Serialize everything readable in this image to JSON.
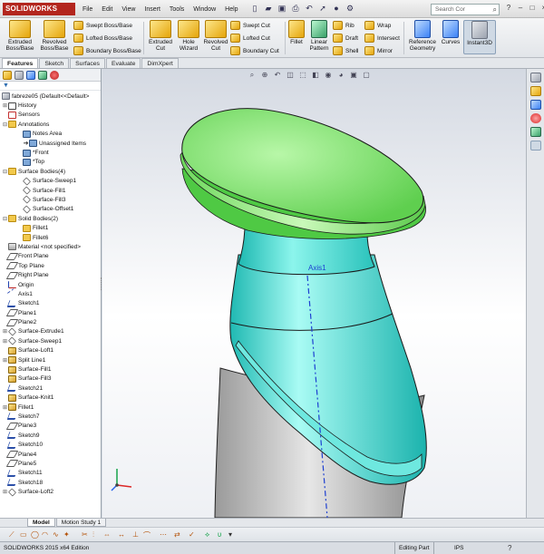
{
  "app": {
    "logo": "SOLIDWORKS"
  },
  "menu": [
    "File",
    "Edit",
    "View",
    "Insert",
    "Tools",
    "Window",
    "Help"
  ],
  "quick_access": [
    "new-icon",
    "open-icon",
    "save-icon",
    "print-icon",
    "undo-icon",
    "select-icon",
    "rebuild-icon",
    "options-icon"
  ],
  "search": {
    "placeholder": "Search Cor"
  },
  "window_controls": [
    "?",
    "–",
    "□",
    "×"
  ],
  "commands": {
    "extruded_boss": "Extruded Boss/Base",
    "revolved_boss": "Revolved Boss/Base",
    "swept_boss": "Swept Boss/Base",
    "lofted_boss": "Lofted Boss/Base",
    "boundary_boss": "Boundary Boss/Base",
    "extruded_cut": "Extruded Cut",
    "hole_wizard": "Hole Wizard",
    "revolved_cut": "Revolved Cut",
    "swept_cut": "Swept Cut",
    "lofted_cut": "Lofted Cut",
    "boundary_cut": "Boundary Cut",
    "fillet": "Fillet",
    "linear_pattern": "Linear Pattern",
    "rib": "Rib",
    "draft": "Draft",
    "shell": "Shell",
    "wrap": "Wrap",
    "intersect": "Intersect",
    "mirror": "Mirror",
    "reference_geometry": "Reference Geometry",
    "curves": "Curves",
    "instant3d": "Instant3D"
  },
  "tabs": [
    "Features",
    "Sketch",
    "Surfaces",
    "Evaluate",
    "DimXpert"
  ],
  "tree": {
    "filter": "▼",
    "root": "fabreze05  (Default<<Default>",
    "items": [
      {
        "label": "History",
        "icon": "history-icon",
        "exp": "⊞",
        "indent": 1
      },
      {
        "label": "Sensors",
        "icon": "sensor-icon",
        "exp": "",
        "indent": 1
      },
      {
        "label": "Annotations",
        "icon": "annotation-icon",
        "exp": "⊟",
        "indent": 1
      },
      {
        "label": "Notes Area",
        "icon": "notes-icon",
        "exp": "",
        "indent": 2
      },
      {
        "label": "Unassigned Items",
        "icon": "notes-icon",
        "exp": "",
        "indent": 2,
        "arrow": true
      },
      {
        "label": "*Front",
        "icon": "notes-icon",
        "exp": "",
        "indent": 2
      },
      {
        "label": "*Top",
        "icon": "notes-icon",
        "exp": "",
        "indent": 2
      },
      {
        "label": "Surface Bodies(4)",
        "icon": "folder-icon",
        "exp": "⊟",
        "indent": 1
      },
      {
        "label": "Surface-Sweep1",
        "icon": "surface-icon",
        "exp": "",
        "indent": 2
      },
      {
        "label": "Surface-Fill1",
        "icon": "surface-icon",
        "exp": "",
        "indent": 2
      },
      {
        "label": "Surface-Fill3",
        "icon": "surface-icon",
        "exp": "",
        "indent": 2
      },
      {
        "label": "Surface-Offset1",
        "icon": "surface-icon",
        "exp": "",
        "indent": 2
      },
      {
        "label": "Solid Bodies(2)",
        "icon": "folder-icon",
        "exp": "⊟",
        "indent": 1
      },
      {
        "label": "Fillet1",
        "icon": "folder-icon",
        "exp": "",
        "indent": 2
      },
      {
        "label": "Fillet6",
        "icon": "folder-icon",
        "exp": "",
        "indent": 2
      },
      {
        "label": "Material <not specified>",
        "icon": "material-icon",
        "exp": "",
        "indent": 1
      },
      {
        "label": "Front Plane",
        "icon": "plane-icon",
        "exp": "",
        "indent": 1
      },
      {
        "label": "Top Plane",
        "icon": "plane-icon",
        "exp": "",
        "indent": 1
      },
      {
        "label": "Right Plane",
        "icon": "plane-icon",
        "exp": "",
        "indent": 1
      },
      {
        "label": "Origin",
        "icon": "origin-icon",
        "exp": "",
        "indent": 1
      },
      {
        "label": "Axis1",
        "icon": "axis-icon",
        "exp": "",
        "indent": 1
      },
      {
        "label": "Sketch1",
        "icon": "sketch-icon",
        "exp": "",
        "indent": 1
      },
      {
        "label": "Plane1",
        "icon": "plane-icon",
        "exp": "",
        "indent": 1
      },
      {
        "label": "Plane2",
        "icon": "plane-icon",
        "exp": "",
        "indent": 1
      },
      {
        "label": "Surface-Extrude1",
        "icon": "surface-icon",
        "exp": "⊞",
        "indent": 1
      },
      {
        "label": "Surface-Sweep1",
        "icon": "surface-icon",
        "exp": "⊞",
        "indent": 1
      },
      {
        "label": "Surface-Loft1",
        "icon": "feature-icon",
        "exp": "",
        "indent": 1
      },
      {
        "label": "Split Line1",
        "icon": "feature-icon",
        "exp": "⊞",
        "indent": 1
      },
      {
        "label": "Surface-Fill1",
        "icon": "feature-icon",
        "exp": "",
        "indent": 1
      },
      {
        "label": "Surface-Fill3",
        "icon": "feature-icon",
        "exp": "",
        "indent": 1
      },
      {
        "label": "Sketch21",
        "icon": "sketch-icon",
        "exp": "",
        "indent": 1
      },
      {
        "label": "Surface-Knit1",
        "icon": "feature-icon",
        "exp": "",
        "indent": 1
      },
      {
        "label": "Fillet1",
        "icon": "feature-icon",
        "exp": "⊞",
        "indent": 1
      },
      {
        "label": "Sketch7",
        "icon": "sketch-icon",
        "exp": "",
        "indent": 1
      },
      {
        "label": "Plane3",
        "icon": "plane-icon",
        "exp": "",
        "indent": 1
      },
      {
        "label": "Sketch9",
        "icon": "sketch-icon",
        "exp": "",
        "indent": 1
      },
      {
        "label": "Sketch10",
        "icon": "sketch-icon",
        "exp": "",
        "indent": 1
      },
      {
        "label": "Plane4",
        "icon": "plane-icon",
        "exp": "",
        "indent": 1
      },
      {
        "label": "Plane5",
        "icon": "plane-icon",
        "exp": "",
        "indent": 1
      },
      {
        "label": "Sketch11",
        "icon": "sketch-icon",
        "exp": "",
        "indent": 1
      },
      {
        "label": "Sketch18",
        "icon": "sketch-icon",
        "exp": "",
        "indent": 1
      },
      {
        "label": "Surface-Loft2",
        "icon": "surface-icon",
        "exp": "⊞",
        "indent": 1
      }
    ]
  },
  "viewport": {
    "axis_label": "Axis1",
    "colors": {
      "top": "#7ee067",
      "mid": "#3fe0d8",
      "base": "#c9c9c9",
      "edge": "#1a1a1a"
    }
  },
  "bottom_tabs": [
    "Model",
    "Motion Study 1"
  ],
  "status": {
    "edition": "SOLIDWORKS 2015 x64 Edition",
    "mode": "Editing Part",
    "units": "IPS",
    "help": "?"
  }
}
